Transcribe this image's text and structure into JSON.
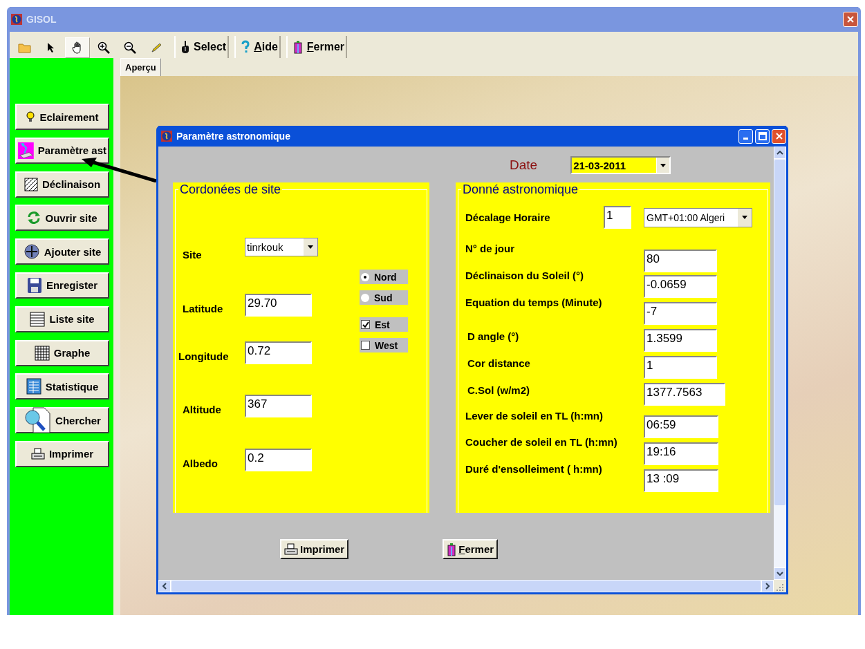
{
  "window": {
    "title": "GISOL"
  },
  "toolbar": {
    "tools": [
      {
        "kind": "folder",
        "selected": false
      },
      {
        "kind": "pointer",
        "selected": false
      },
      {
        "kind": "hand",
        "selected": true
      },
      {
        "kind": "zoom-in",
        "selected": false
      },
      {
        "kind": "zoom-out",
        "selected": false
      },
      {
        "kind": "pencil",
        "selected": false
      }
    ],
    "buttons": [
      {
        "kind": "select",
        "label": "Select",
        "underline_first": false
      },
      {
        "kind": "help",
        "label": "Aide",
        "underline_first": true
      },
      {
        "kind": "exit",
        "label": "Fermer",
        "underline_first": true
      }
    ]
  },
  "sidebar": {
    "items": [
      {
        "kind": "bulb",
        "label": "Eclairement"
      },
      {
        "kind": "lamp",
        "label": "Paramètre ast"
      },
      {
        "kind": "hatch",
        "label": "Déclinaison"
      },
      {
        "kind": "refresh",
        "label": "Ouvrir site"
      },
      {
        "kind": "cross",
        "label": "Ajouter site"
      },
      {
        "kind": "floppy",
        "label": "Enregister"
      },
      {
        "kind": "list",
        "label": "Liste site"
      },
      {
        "kind": "grid",
        "label": "Graphe"
      },
      {
        "kind": "sheet",
        "label": "Statistique"
      },
      {
        "kind": "search",
        "label": "Chercher"
      },
      {
        "kind": "printer",
        "label": "Imprimer"
      }
    ]
  },
  "tabs": [
    {
      "label": "Aperçu",
      "selected": true
    }
  ],
  "dialog": {
    "title": "Paramètre astronomique",
    "date": {
      "label": "Date",
      "value": "21-03-2011"
    },
    "site_group": {
      "title": "Cordonées de site",
      "fields": [
        {
          "kind": "combo",
          "label": "Site",
          "value": "tinrkouk"
        },
        {
          "kind": "text",
          "label": "Latitude",
          "value": "29.70"
        },
        {
          "kind": "text",
          "label": "Longitude",
          "value": "0.72"
        },
        {
          "kind": "text",
          "label": "Altitude",
          "value": "367"
        },
        {
          "kind": "text",
          "label": "Albedo",
          "value": "0.2"
        }
      ],
      "radios": [
        {
          "label": "Nord",
          "selected": true
        },
        {
          "label": "Sud",
          "selected": false
        }
      ],
      "checkboxes": [
        {
          "label": "Est",
          "checked": true
        },
        {
          "label": "West",
          "checked": false
        }
      ]
    },
    "astro_group": {
      "title": "Donné astronomique",
      "offset": {
        "label": "Décalage Horaire",
        "value": "1",
        "zone": "GMT+01:00 Algeri"
      },
      "fields": [
        {
          "label": "N° de jour",
          "value": "80"
        },
        {
          "label": "Déclinaison du Soleil (°)",
          "value": "-0.0659"
        },
        {
          "label": "Equation du temps (Minute)",
          "value": "-7"
        },
        {
          "label": "D angle (°)",
          "value": "1.3599"
        },
        {
          "label": "Cor distance",
          "value": "1"
        },
        {
          "label": "C.Sol (w/m2)",
          "value": "1377.7563"
        },
        {
          "label": "Lever de soleil en TL (h:mn)",
          "value": "06:59"
        },
        {
          "label": "Coucher de soleil en TL (h:mn)",
          "value": "19:16"
        },
        {
          "label": "Duré d'ensolleiment ( h:mn)",
          "value": "13 :09"
        }
      ]
    },
    "buttons": [
      {
        "kind": "printer",
        "label": "Imprimer",
        "underline_first": false
      },
      {
        "kind": "exit",
        "label": "Fermer",
        "underline_first": true
      }
    ]
  }
}
